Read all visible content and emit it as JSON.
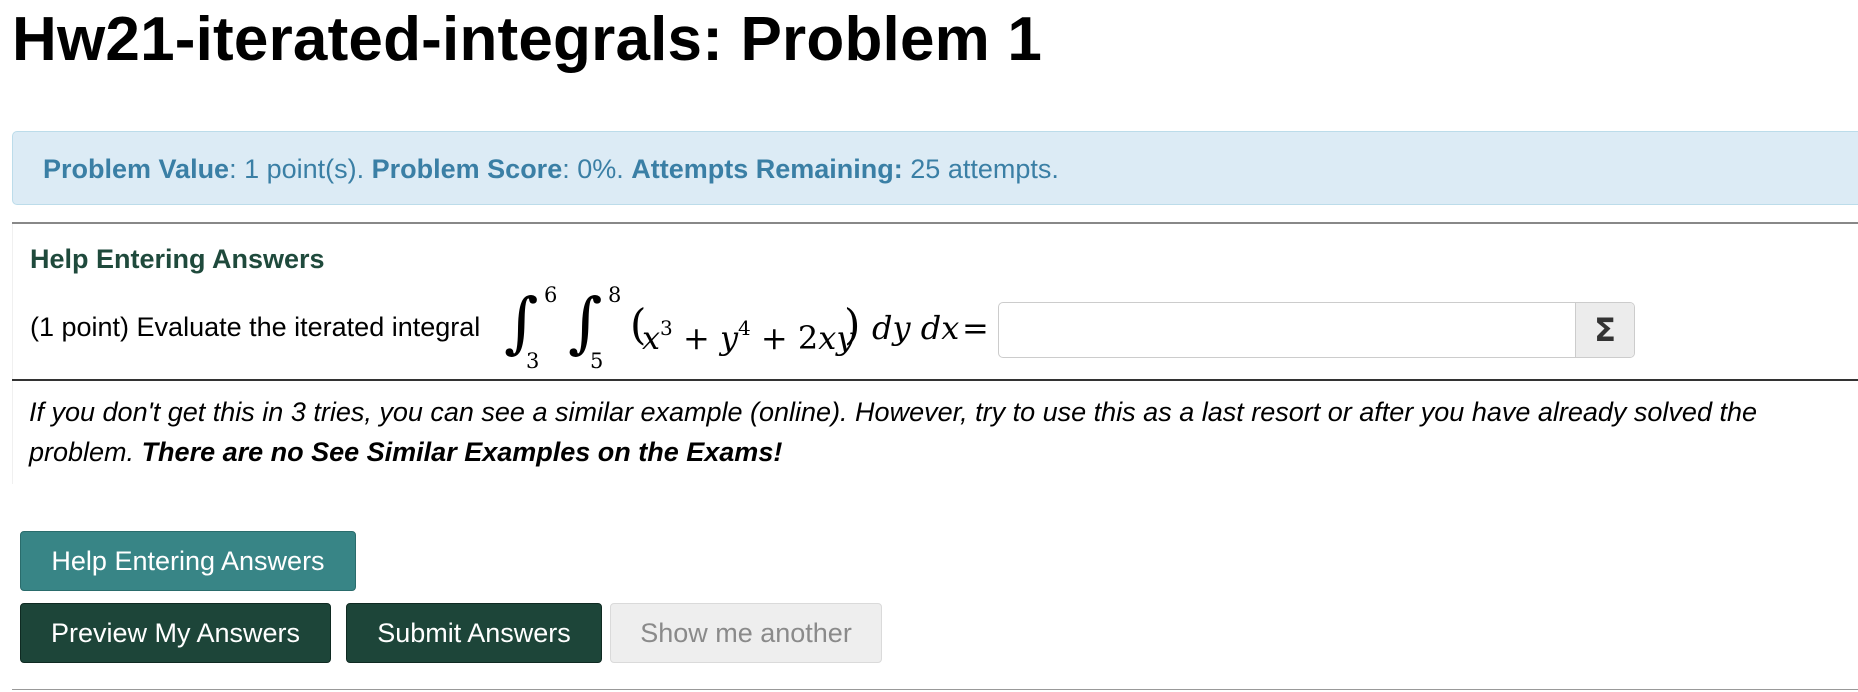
{
  "page_title": "Hw21-iterated-integrals: Problem 1",
  "info_bar": {
    "value_label": "Problem Value",
    "value_text": ": 1 point(s). ",
    "score_label": "Problem Score",
    "score_text": ": 0%. ",
    "attempts_label": "Attempts Remaining:",
    "attempts_text": " 25 attempts."
  },
  "help_link": "Help Entering Answers",
  "problem": {
    "prompt": "(1 point) Evaluate the iterated integral",
    "outer_integral": {
      "lower": "3",
      "upper": "6"
    },
    "inner_integral": {
      "lower": "5",
      "upper": "8"
    },
    "integrand": {
      "open_paren": "(",
      "x": "x",
      "x_exp": "3",
      "plus1": " + ",
      "y": "y",
      "y_exp": "4",
      "plus2": " + ",
      "coef": "2",
      "xy": "xy",
      "close_paren": ")"
    },
    "differentials": "dy dx",
    "equals": "="
  },
  "answer": {
    "value": "",
    "placeholder": "",
    "equation_button_icon": "Σ"
  },
  "hint": {
    "text": "If you don't get this in 3 tries, you can see a similar example (online). However, try to use this as a last resort or after you have already solved the problem. ",
    "bold_text": "There are no See Similar Examples on the Exams!"
  },
  "buttons": {
    "help": "Help Entering Answers",
    "preview": "Preview My Answers",
    "submit": "Submit Answers",
    "show_another": "Show me another"
  }
}
